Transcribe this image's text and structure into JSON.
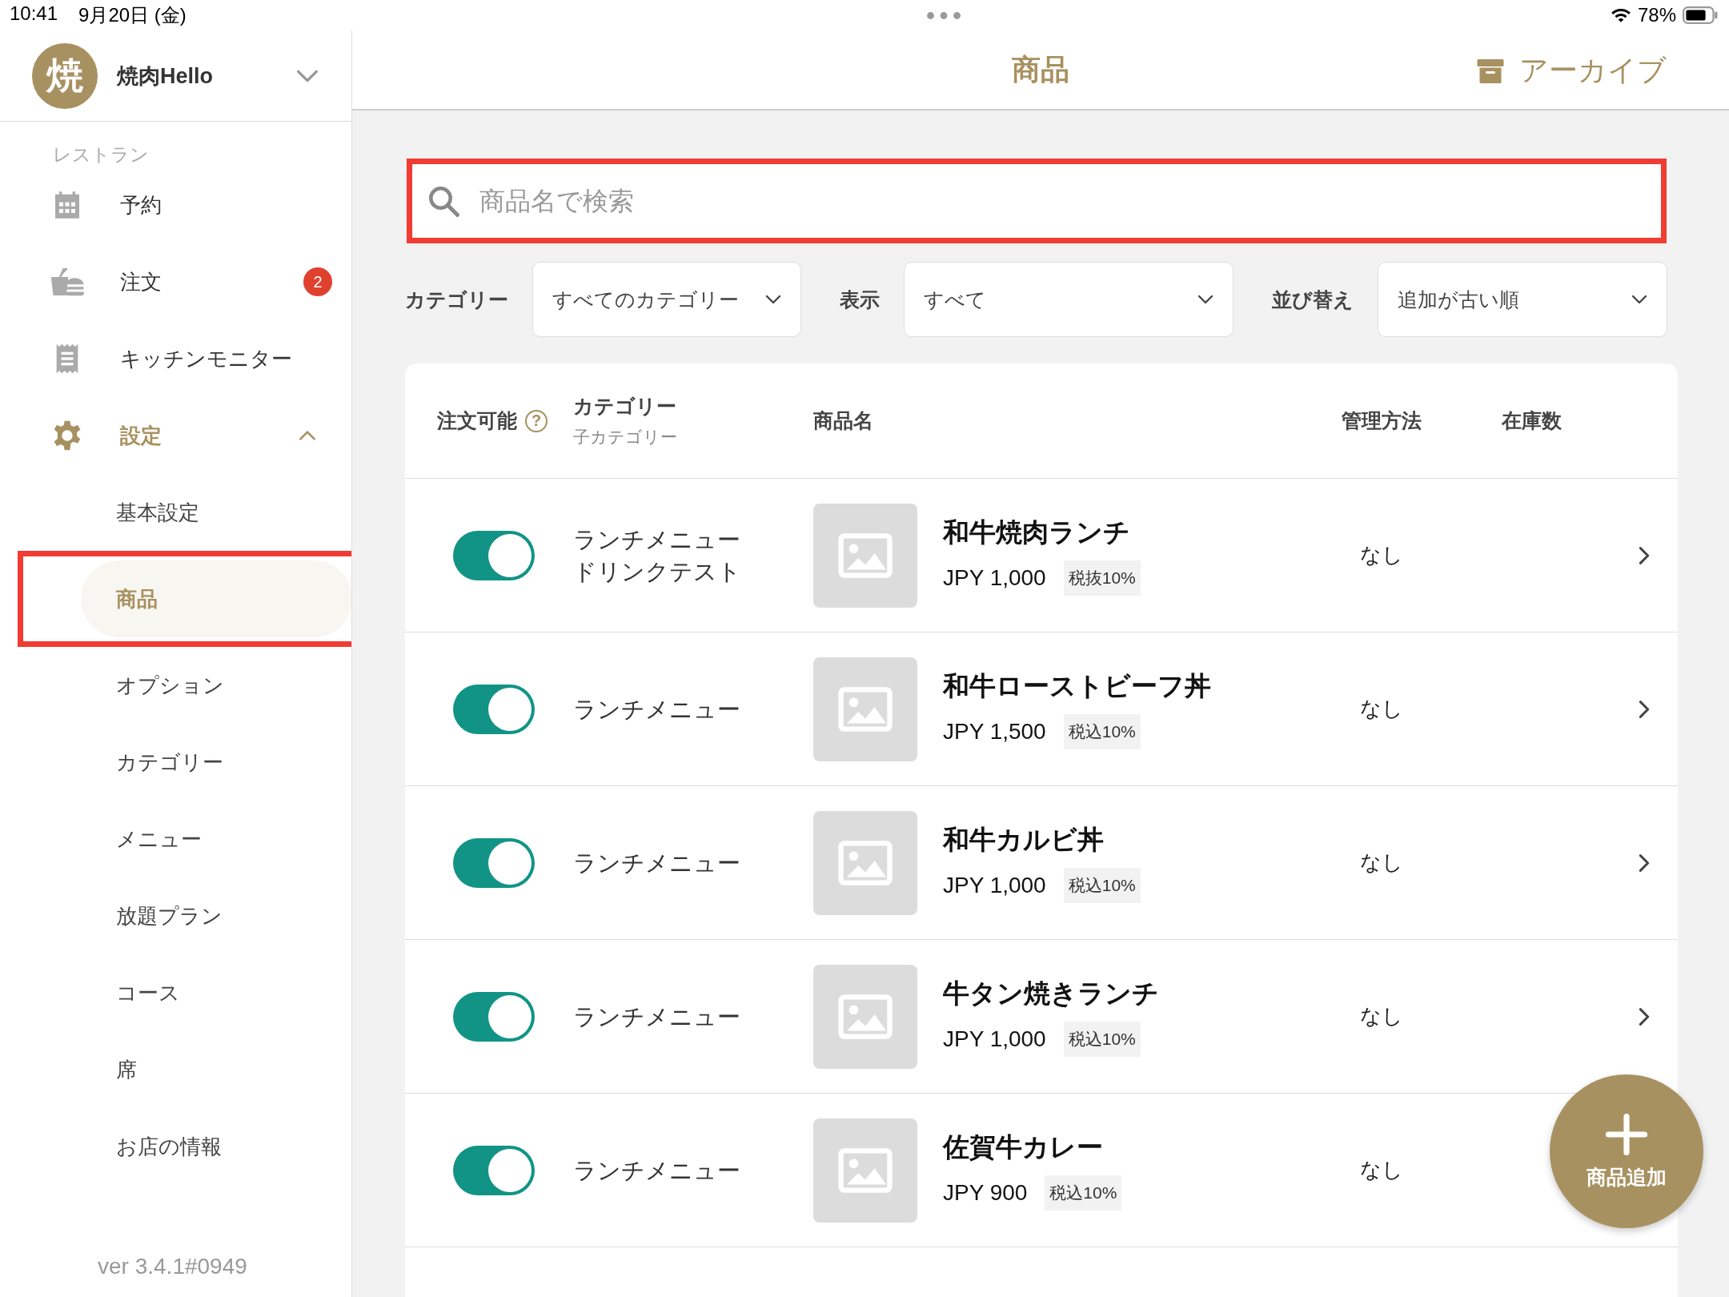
{
  "status_bar": {
    "time": "10:41",
    "date": "9月20日 (金)",
    "battery": "78%"
  },
  "sidebar": {
    "shop": {
      "avatar": "焼",
      "name": "焼肉Hello"
    },
    "section": "レストラン",
    "items": [
      {
        "label": "予約",
        "selected": false
      },
      {
        "label": "注文",
        "selected": false,
        "badge": "2"
      },
      {
        "label": "キッチンモニター",
        "selected": false
      },
      {
        "label": "設定",
        "selected": true,
        "expanded": true,
        "children": [
          {
            "label": "基本設定",
            "selected": false,
            "highlighted": false
          },
          {
            "label": "商品",
            "selected": true,
            "highlighted": true
          },
          {
            "label": "オプション",
            "selected": false,
            "highlighted": false
          },
          {
            "label": "カテゴリー",
            "selected": false,
            "highlighted": false
          },
          {
            "label": "メニュー",
            "selected": false,
            "highlighted": false
          },
          {
            "label": "放題プラン",
            "selected": false,
            "highlighted": false
          },
          {
            "label": "コース",
            "selected": false,
            "highlighted": false
          },
          {
            "label": "席",
            "selected": false,
            "highlighted": false
          },
          {
            "label": "お店の情報",
            "selected": false,
            "highlighted": false
          }
        ]
      }
    ],
    "version": "ver 3.4.1#0949"
  },
  "header": {
    "title": "商品",
    "archive": "アーカイブ"
  },
  "search": {
    "placeholder": "商品名で検索",
    "highlighted": true
  },
  "filters": [
    {
      "label": "カテゴリー",
      "value": "すべてのカテゴリー"
    },
    {
      "label": "表示",
      "value": "すべて"
    },
    {
      "label": "並び替え",
      "value": "追加が古い順"
    }
  ],
  "table": {
    "columns": [
      {
        "label": "注文可能",
        "help": "?"
      },
      {
        "label": "カテゴリー",
        "sublabel": "子カテゴリー"
      },
      {
        "label": "商品名"
      },
      {
        "label": "管理方法"
      },
      {
        "label": "在庫数"
      }
    ],
    "rows": [
      {
        "available": true,
        "category": "ランチメニュー",
        "subcategory": "ドリンクテスト",
        "name": "和牛焼肉ランチ",
        "price": "JPY 1,000",
        "tax": "税抜10%",
        "management": "なし",
        "arrow": true
      },
      {
        "available": true,
        "category": "ランチメニュー",
        "name": "和牛ローストビーフ丼",
        "price": "JPY 1,500",
        "tax": "税込10%",
        "management": "なし",
        "arrow": true
      },
      {
        "available": true,
        "category": "ランチメニュー",
        "name": "和牛カルビ丼",
        "price": "JPY 1,000",
        "tax": "税込10%",
        "management": "なし",
        "arrow": true
      },
      {
        "available": true,
        "category": "ランチメニュー",
        "name": "牛タン焼きランチ",
        "price": "JPY 1,000",
        "tax": "税込10%",
        "management": "なし",
        "arrow": true
      },
      {
        "available": true,
        "category": "ランチメニュー",
        "name": "佐賀牛カレー",
        "price": "JPY 900",
        "tax": "税込10%",
        "management": "なし",
        "arrow": false
      }
    ]
  },
  "fab": {
    "label": "商品追加"
  }
}
